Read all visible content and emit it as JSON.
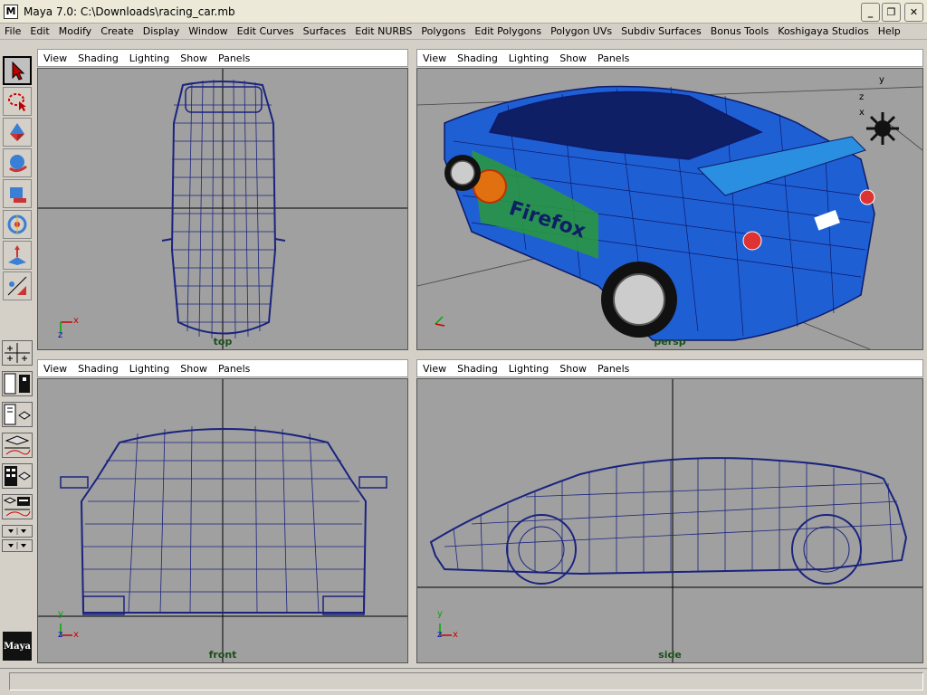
{
  "window": {
    "logo": "M",
    "title": "Maya 7.0: C:\\Downloads\\racing_car.mb",
    "buttons": [
      "_",
      "❐",
      "✕"
    ]
  },
  "menu": [
    "File",
    "Edit",
    "Modify",
    "Create",
    "Display",
    "Window",
    "Edit Curves",
    "Surfaces",
    "Edit NURBS",
    "Polygons",
    "Edit Polygons",
    "Polygon UVs",
    "Subdiv Surfaces",
    "Bonus Tools",
    "Koshigaya Studios",
    "Help"
  ],
  "panel_menu": [
    "View",
    "Shading",
    "Lighting",
    "Show",
    "Panels"
  ],
  "panels": {
    "top": {
      "camera": "top"
    },
    "persp": {
      "camera": "persp",
      "decal": "Firefox"
    },
    "front": {
      "camera": "front"
    },
    "side": {
      "camera": "side"
    }
  },
  "axes": {
    "x": "x",
    "y": "y",
    "z": "z"
  },
  "logo_text": "Maya",
  "status": {
    "value": ""
  },
  "colors": {
    "viewport_bg": "#a0a0a0",
    "wire": "#1a237e",
    "car_blue": "#1f5fd4",
    "label_green": "#1a4f1a"
  }
}
